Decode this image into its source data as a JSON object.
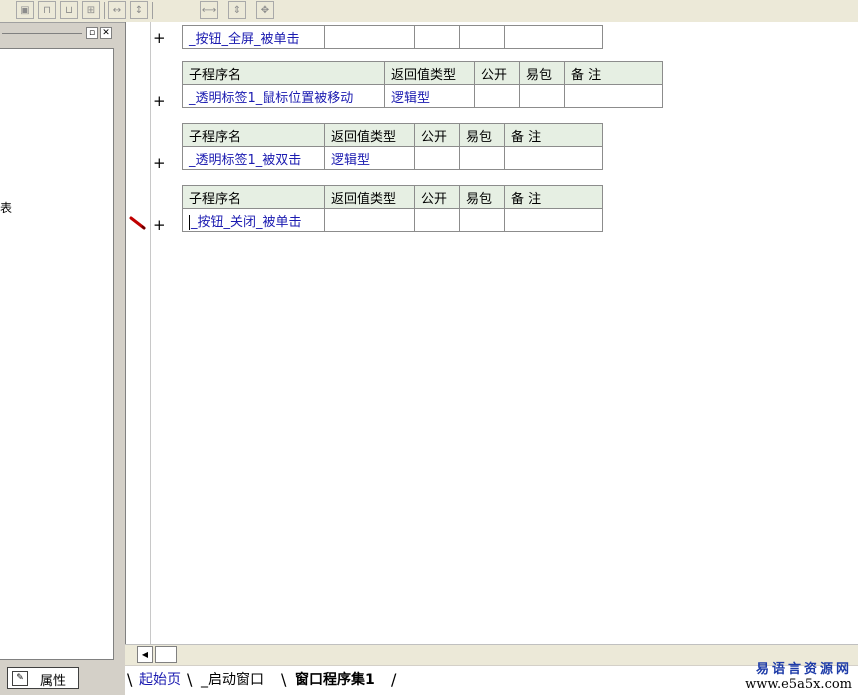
{
  "left_panel": {
    "visible_glyph": "表"
  },
  "bottom_left_tab": {
    "label": "属性"
  },
  "blocks": [
    {
      "rows": [
        [
          "_按钮_全屏_被单击",
          "",
          "",
          "",
          ""
        ]
      ]
    },
    {
      "headers": [
        "子程序名",
        "返回值类型",
        "公开",
        "易包",
        "备 注"
      ],
      "rows": [
        [
          "_透明标签1_鼠标位置被移动",
          "逻辑型",
          "",
          "",
          ""
        ]
      ]
    },
    {
      "headers": [
        "子程序名",
        "返回值类型",
        "公开",
        "易包",
        "备 注"
      ],
      "rows": [
        [
          "_透明标签1_被双击",
          "逻辑型",
          "",
          "",
          ""
        ]
      ]
    },
    {
      "headers": [
        "子程序名",
        "返回值类型",
        "公开",
        "易包",
        "备 注"
      ],
      "rows": [
        [
          "_按钮_关闭_被单击",
          "",
          "",
          "",
          ""
        ]
      ]
    }
  ],
  "expand_symbol": "+",
  "doc_tabs": [
    {
      "label": "起始页",
      "selected": false
    },
    {
      "label": "_启动窗口",
      "selected": false
    },
    {
      "label": "窗口程序集1",
      "selected": true
    }
  ],
  "watermark": {
    "cn": "易语言资源网",
    "en": "www.e5a5x.com"
  },
  "colors": {
    "header_bg": "#e6efe3",
    "type_text": "#1a1ab0",
    "tab_link": "#1a1ab0"
  }
}
